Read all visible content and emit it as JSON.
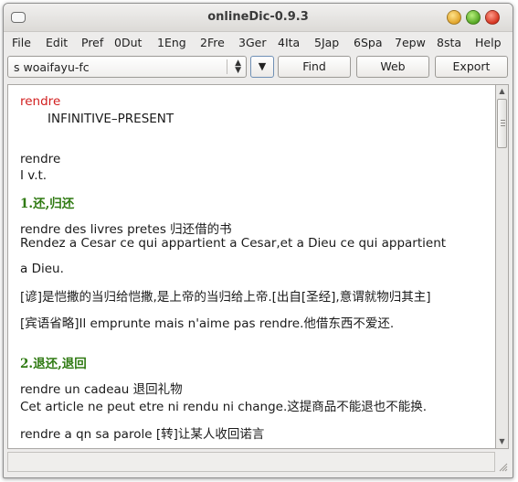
{
  "window": {
    "title": "onlineDic-0.9.3"
  },
  "menu": [
    "File",
    "Edit",
    "Pref",
    "0Dut",
    "1Eng",
    "2Fre",
    "3Ger",
    "4Ita",
    "5Jap",
    "6Spa",
    "7epw",
    "8sta",
    "Help"
  ],
  "toolbar": {
    "dictionary_value": "s woaifayu-fc",
    "find_label": "Find",
    "web_label": "Web",
    "export_label": "Export"
  },
  "entry": {
    "headword": "rendre",
    "form": "INFINITIVE–PRESENT",
    "headword2": "rendre",
    "pos": "I v.t.",
    "sense1_heading": "1.还,归还",
    "ex1": "rendre des livres pretes 归还借的书",
    "ex2a": "Rendez a Cesar ce qui appartient a Cesar,et a Dieu ce qui appartient",
    "ex2b": "a Dieu.",
    "ex3": "[谚]是恺撒的当归给恺撒,是上帝的当归给上帝.[出自[圣经],意谓就物归其主]",
    "ex4": "[宾语省略]Il emprunte mais n'aime pas rendre.他借东西不爱还.",
    "sense2_heading": "2.退还,退回",
    "ex5": "rendre un cadeau 退回礼物",
    "ex6": "Cet article ne peut etre ni rendu ni change.这提商品不能退也不能换.",
    "ex7": "rendre a qn sa parole [转]让某人收回诺言"
  },
  "colors": {
    "headword": "#d21f1f",
    "sense_heading": "#2f7a12"
  }
}
